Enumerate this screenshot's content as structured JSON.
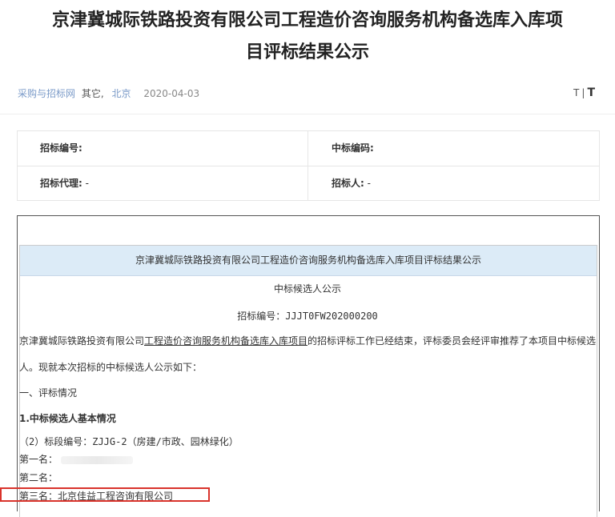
{
  "header": {
    "title_line1": "京津冀城际铁路投资有限公司工程造价咨询服务机构备选库入库项",
    "title_line2": "目评标结果公示"
  },
  "meta": {
    "source": "采购与招标网",
    "category": "其它,",
    "region": "北京",
    "date": "2020-04-03",
    "font_small": "T",
    "font_large": "T"
  },
  "info": {
    "bid_no_label": "招标编号:",
    "win_no_label": "中标编码:",
    "agent_label": "招标代理:",
    "agent_value": "-",
    "tenderer_label": "招标人:",
    "tenderer_value": "-"
  },
  "content": {
    "banner": "京津冀城际铁路投资有限公司工程造价咨询服务机构备选库入库项目评标结果公示",
    "subtitle": "中标候选人公示",
    "bid_no_line": "招标编号：JJJT0FW202000200",
    "para1_prefix": "京津冀城际铁路投资有限公司",
    "para1_link": "工程造价咨询服务机构备选库入库项目",
    "para1_suffix": "的招标评标工作已经结束，评标委员会经评审推荐了本项目中标候选",
    "para1_line2": "人。现就本次招标的中标候选人公示如下：",
    "section1": "一、评标情况",
    "section1_1": "1.中标候选人基本情况",
    "lot": "（2）标段编号：ZJJG-2（房建/市政、园林绿化）",
    "first": "第一名：",
    "second": "第二名：",
    "third": "第三名：北京佳益工程咨询有限公司"
  },
  "colors": {
    "banner_bg": "#dcebf7",
    "highlight": "#d9332b",
    "link": "#7a9ac8"
  }
}
